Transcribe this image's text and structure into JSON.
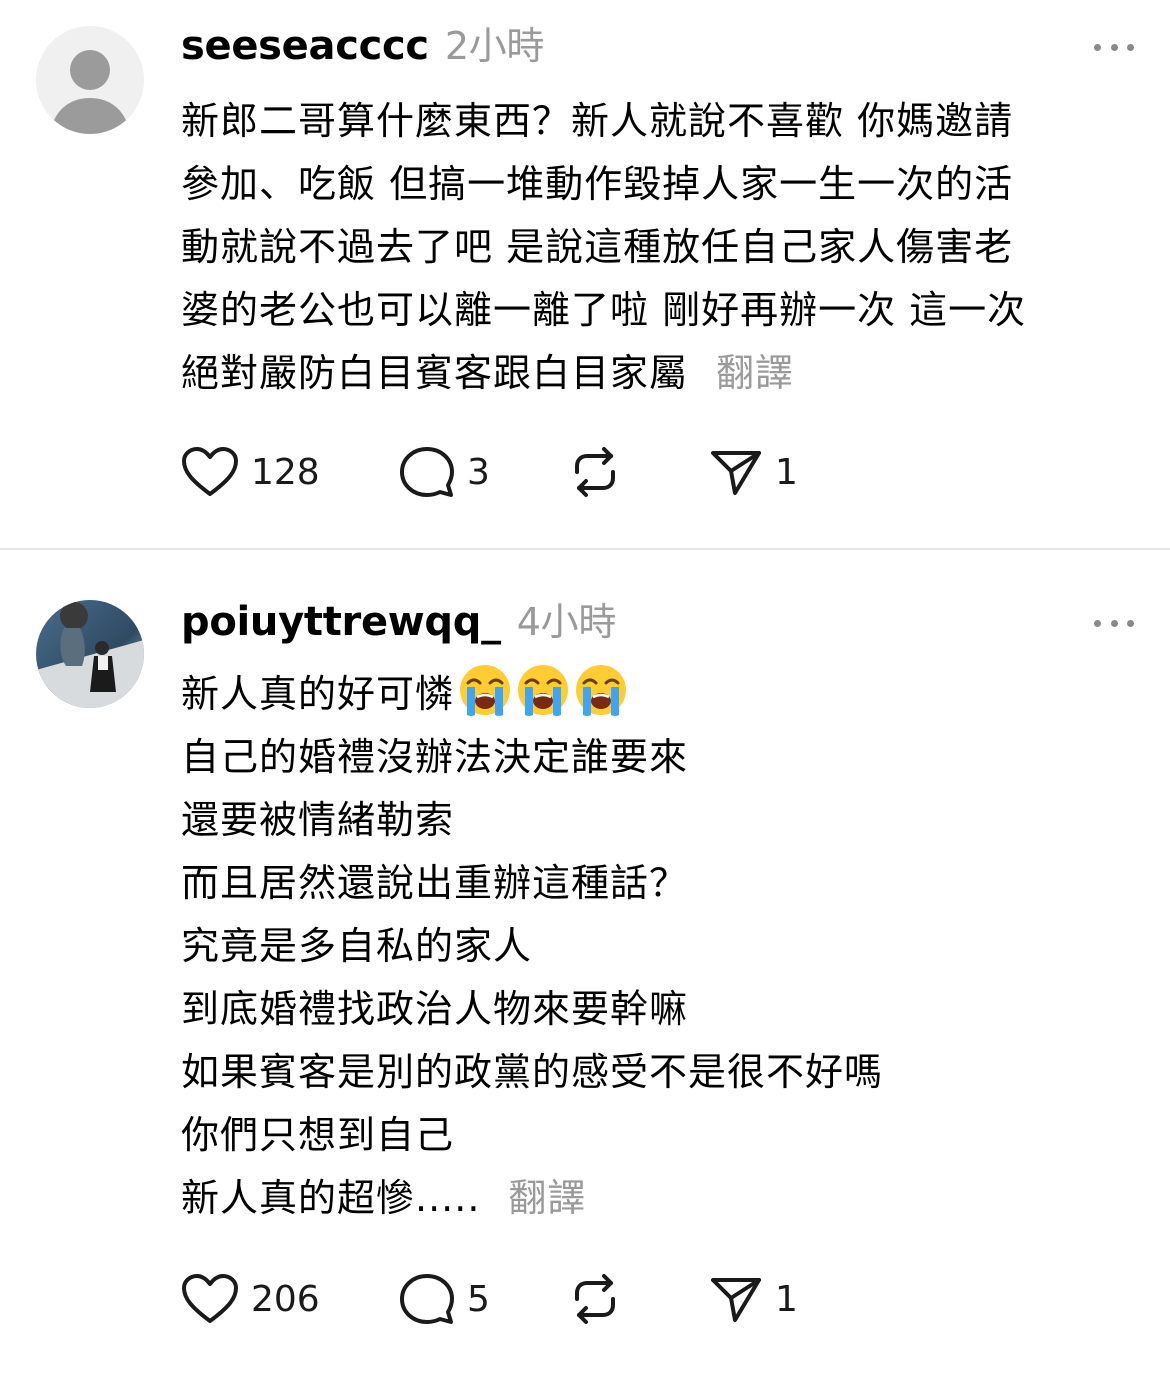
{
  "comments": [
    {
      "username": "seeseacccc",
      "time": "2小時",
      "lines": [
        "新郎二哥算什麼東西？新人就說不喜歡 你媽邀請",
        "參加、吃飯 但搞一堆動作毀掉人家一生一次的活",
        "動就說不過去了吧 是說這種放任自己家人傷害老",
        "婆的老公也可以離一離了啦 剛好再辦一次 這一次",
        "絕對嚴防白目賓客跟白目家屬"
      ],
      "translate_label": "翻譯",
      "likes": "128",
      "replies": "3",
      "shares": "1",
      "avatar": "default-avatar"
    },
    {
      "username": "poiuyttrewqq_",
      "time": "4小時",
      "lines": [
        "新人真的好可憐",
        "自己的婚禮沒辦法決定誰要來",
        "還要被情緒勒索",
        "而且居然還說出重辦這種話？",
        "究竟是多自私的家人",
        "到底婚禮找政治人物來要幹嘛",
        "如果賓客是別的政黨的感受不是很不好嗎",
        "你們只想到自己",
        "新人真的超慘....."
      ],
      "emoji_count": 3,
      "emoji": "loudly-crying-face-emoji",
      "translate_label": "翻譯",
      "likes": "206",
      "replies": "5",
      "shares": "1",
      "avatar": "photo-avatar"
    }
  ],
  "colors": {
    "secondary_text": "#9a9a9a",
    "divider": "#e5e5e5",
    "icon": "#1a1a1a"
  }
}
